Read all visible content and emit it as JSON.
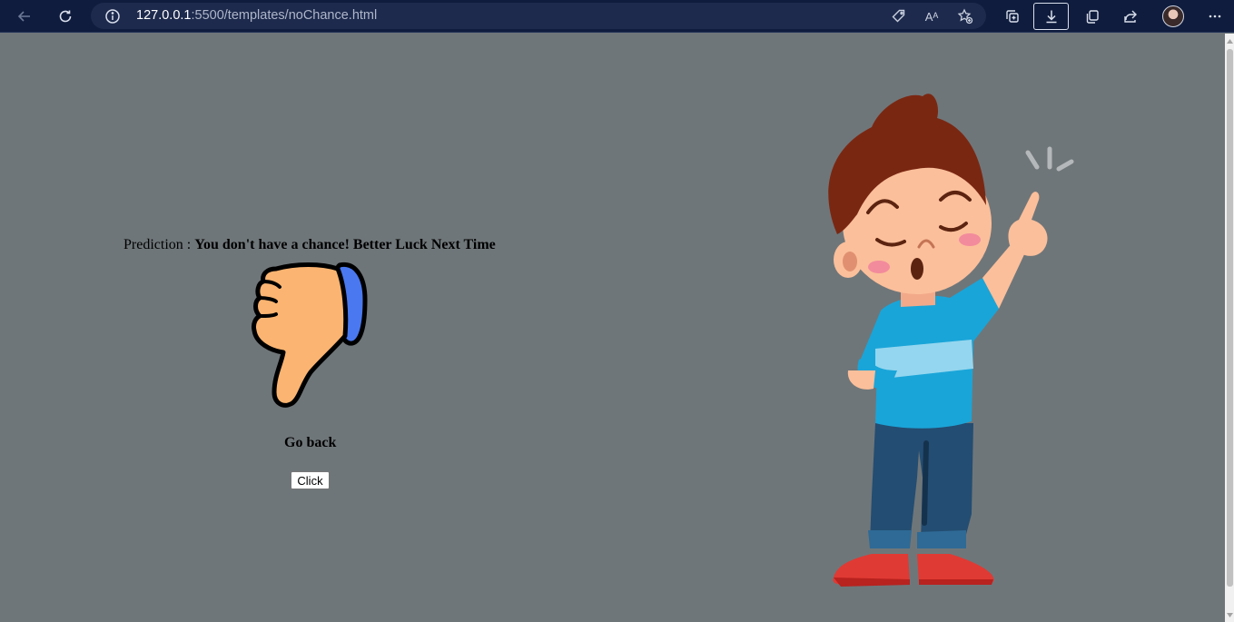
{
  "browser": {
    "url_host": "127.0.0.1",
    "url_rest": ":5500/templates/noChance.html",
    "read_aloud_label": "Aᴬ"
  },
  "page": {
    "prediction_label": "Prediction : ",
    "prediction_result": "You don't have a chance! Better Luck Next Time",
    "goback_label": "Go back",
    "click_button_label": "Click"
  },
  "colors": {
    "page_background": "#6f7679",
    "toolbar": "#0f1c3d"
  }
}
